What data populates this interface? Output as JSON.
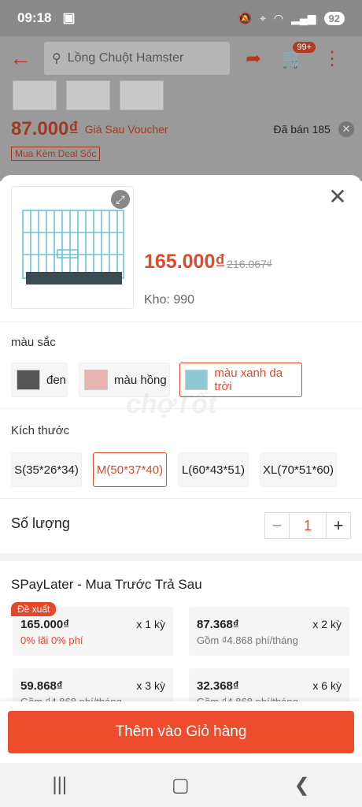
{
  "status_bar": {
    "time": "09:18",
    "battery": "92"
  },
  "background": {
    "search_placeholder": "Lồng Chuột Hamster",
    "cart_badge": "99+",
    "price": "87.000₫",
    "voucher_label": "Giá Sau Voucher",
    "sold": "Đã bán 185",
    "deal_badge": "Mua Kèm Deal Sốc"
  },
  "sheet": {
    "sale_price": "165.000₫",
    "original_price": "216.067₫",
    "stock": "Kho: 990",
    "color_label": "màu sắc",
    "colors": [
      {
        "label": "đen",
        "swatch": "#555555"
      },
      {
        "label": "màu hồng",
        "swatch": "#e7b4b0"
      },
      {
        "label": "màu xanh da trời",
        "swatch": "#8fc9d8"
      }
    ],
    "size_label": "Kích thước",
    "sizes": [
      "S(35*26*34)",
      "M(50*37*40)",
      "L(60*43*51)",
      "XL(70*51*60)"
    ],
    "quantity_label": "Số lượng",
    "quantity": "1",
    "minus": "−",
    "plus": "+",
    "spaylater_title": "SPayLater - Mua Trước Trả Sau",
    "suggest_badge": "Đề xuất",
    "plans": [
      {
        "amount": "165.000₫",
        "term": "x 1 kỳ",
        "note": "0% lãi 0% phí"
      },
      {
        "amount": "87.368₫",
        "term": "x 2 kỳ",
        "note": "Gồm ₫4.868 phí/tháng"
      },
      {
        "amount": "59.868₫",
        "term": "x 3 kỳ",
        "note": "Gồm ₫4.868 phí/tháng"
      },
      {
        "amount": "32.368₫",
        "term": "x 6 kỳ",
        "note": "Gồm ₫4.868 phí/tháng"
      }
    ],
    "watermark": "chợTốt"
  },
  "footer": {
    "add_to_cart": "Thêm vào Giỏ hàng"
  },
  "colors": {
    "accent": "#ee4d2d",
    "dim_overlay": "#9a9a9a"
  }
}
